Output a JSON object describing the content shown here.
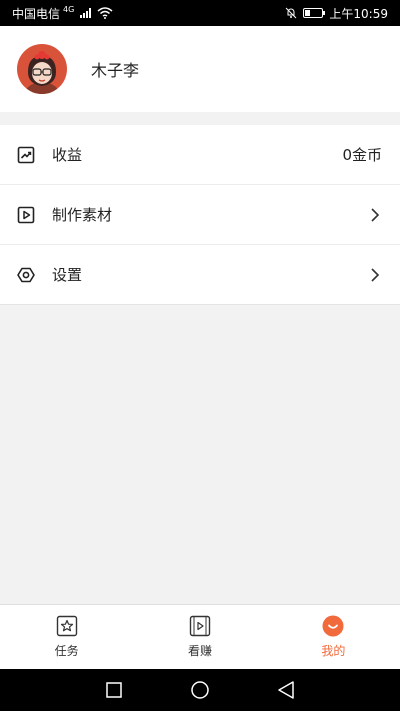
{
  "status_bar": {
    "carrier": "中国电信",
    "network": "4G",
    "time": "上午10:59",
    "battery_level": 0.3
  },
  "profile": {
    "name": "木子李"
  },
  "menu": {
    "items": [
      {
        "label": "收益",
        "value": "0金币",
        "icon": "chart-trend-icon"
      },
      {
        "label": "制作素材",
        "value": "",
        "icon": "play-square-icon"
      },
      {
        "label": "设置",
        "value": "",
        "icon": "settings-hexagon-icon"
      }
    ]
  },
  "tabs": [
    {
      "label": "任务",
      "icon": "star-square-icon",
      "active": false
    },
    {
      "label": "看赚",
      "icon": "video-frame-icon",
      "active": false
    },
    {
      "label": "我的",
      "icon": "smile-circle-icon",
      "active": true
    }
  ],
  "colors": {
    "accent": "#f06a3b",
    "background": "#f2f2f2"
  }
}
